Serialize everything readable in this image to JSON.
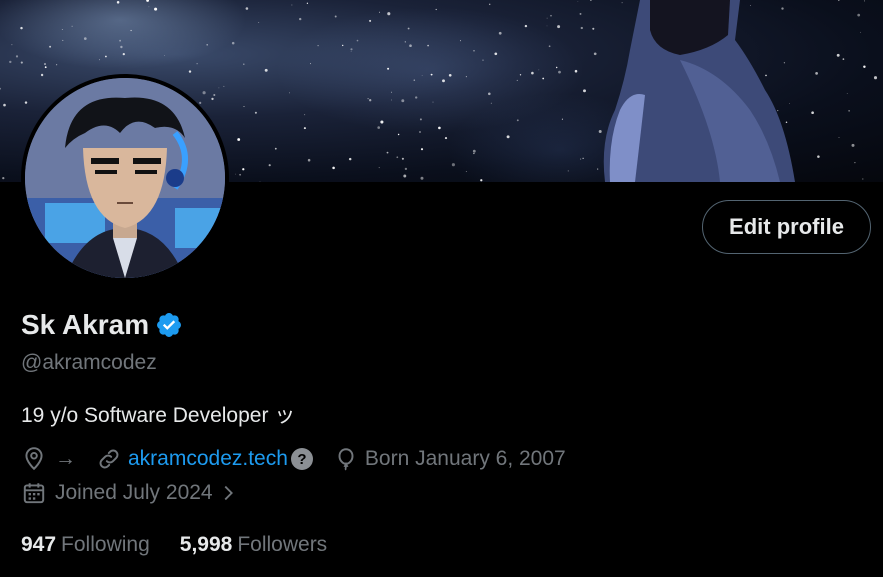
{
  "profile": {
    "name": "Sk Akram",
    "handle": "@akramcodez",
    "bio": "19 y/o Software Developer ッ",
    "location_arrow": "→",
    "website": "akramcodez.tech",
    "website_badge": "?",
    "birthday": "Born January 6, 2007",
    "joined": "Joined July 2024"
  },
  "actions": {
    "edit_profile": "Edit profile"
  },
  "stats": {
    "following_count": "947",
    "following_label": "Following",
    "followers_count": "5,998",
    "followers_label": "Followers"
  },
  "colors": {
    "background": "#000000",
    "text_primary": "#e7e9ea",
    "text_secondary": "#71767b",
    "accent": "#1d9bf0",
    "verified": "#1d9bf0"
  },
  "icons": {
    "verified": "verified-badge-icon",
    "location": "location-pin-icon",
    "link": "link-icon",
    "birthday": "balloon-icon",
    "calendar": "calendar-icon",
    "chevron": "chevron-right-icon"
  }
}
